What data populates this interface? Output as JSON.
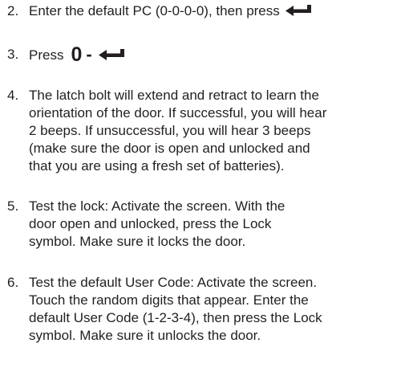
{
  "steps": [
    {
      "number": "2.",
      "lines": [
        "Enter the default PC (0-0-0-0), then press"
      ],
      "trailing_icon": "enter-key-icon"
    },
    {
      "number": "3.",
      "lines": [
        "Press"
      ],
      "key_sequence": [
        "0",
        "-"
      ],
      "trailing_icon": "enter-key-icon"
    },
    {
      "number": "4.",
      "lines": [
        "The latch bolt will extend and retract to learn the",
        "orientation of the door. If successful, you will hear",
        "2 beeps. If unsuccessful, you will hear 3 beeps",
        "(make sure the door is open and unlocked and",
        "that you are using a fresh set of batteries)."
      ]
    },
    {
      "number": "5.",
      "lines": [
        "Test the lock: Activate the screen. With the",
        "door open and unlocked, press the Lock",
        "symbol. Make sure it locks the door."
      ]
    },
    {
      "number": "6.",
      "lines": [
        "Test the default User Code: Activate the screen.",
        "Touch the random digits that appear. Enter the",
        "default User Code (1-2-3-4), then press the Lock",
        "symbol. Make sure it unlocks the door."
      ]
    }
  ],
  "colors": {
    "text": "#231f20",
    "background": "#ffffff"
  }
}
